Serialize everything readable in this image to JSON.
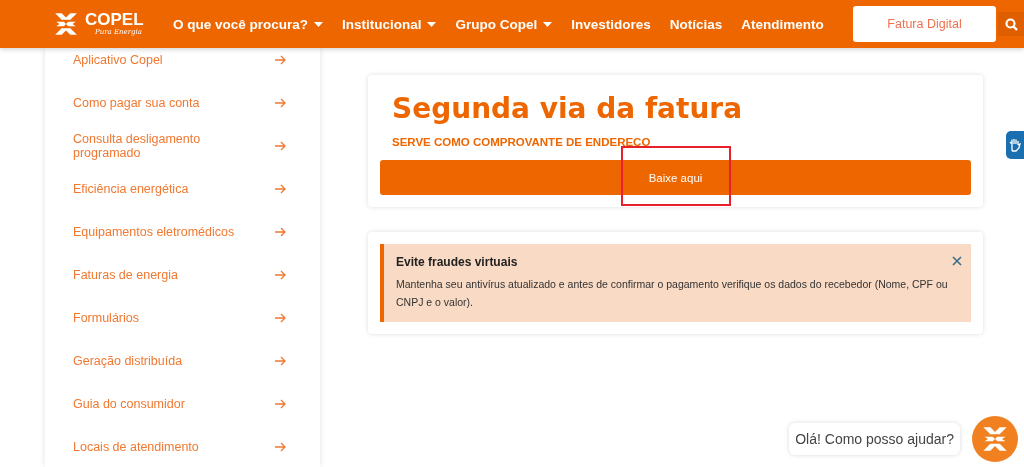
{
  "header": {
    "logo": {
      "name": "COPEL",
      "tagline": "Pura Energia"
    },
    "nav": [
      {
        "label": "O que você procura?",
        "dropdown": true
      },
      {
        "label": "Institucional",
        "dropdown": true
      },
      {
        "label": "Grupo Copel",
        "dropdown": true
      },
      {
        "label": "Investidores",
        "dropdown": false
      },
      {
        "label": "Notícias",
        "dropdown": false
      },
      {
        "label": "Atendimento",
        "dropdown": false
      }
    ],
    "cta": "Fatura Digital"
  },
  "sidebar": {
    "items": [
      {
        "label": "Aplicativo Copel"
      },
      {
        "label": "Como pagar sua conta"
      },
      {
        "label": "Consulta desligamento programado"
      },
      {
        "label": "Eficiência energética"
      },
      {
        "label": "Equipamentos eletromédicos"
      },
      {
        "label": "Faturas de energia"
      },
      {
        "label": "Formulários"
      },
      {
        "label": "Geração distribuída"
      },
      {
        "label": "Guia do consumidor"
      },
      {
        "label": "Locais de atendimento"
      }
    ]
  },
  "invoice_card": {
    "title": "Segunda via da fatura",
    "subtitle": "SERVE COMO COMPROVANTE DE ENDEREÇO",
    "button": "Baixe aqui",
    "highlighted": true
  },
  "alert": {
    "title": "Evite fraudes virtuais",
    "message": "Mantenha seu antivírus atualizado e antes de confirmar o pagamento verifique os dados do recebedor (Nome, CPF ou CNPJ e o valor)."
  },
  "chat": {
    "greeting": "Olá! Como posso ajudar?"
  }
}
